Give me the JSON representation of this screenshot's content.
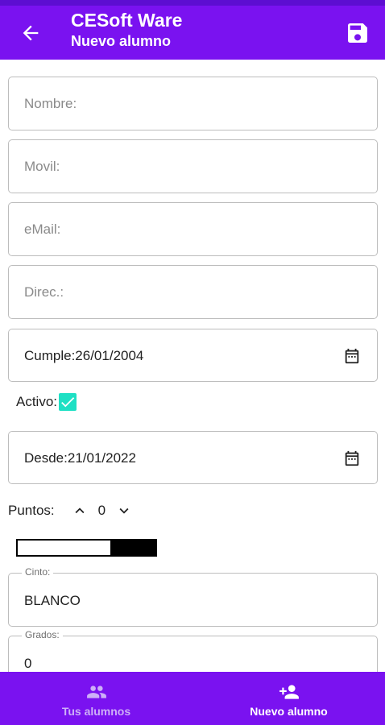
{
  "app_bar": {
    "title": "CESoft Ware",
    "subtitle": "Nuevo alumno",
    "back_icon": "arrow-back-icon",
    "save_icon": "save-icon"
  },
  "form": {
    "nombre_placeholder": "Nombre:",
    "movil_placeholder": "Movil:",
    "email_placeholder": "eMail:",
    "direc_placeholder": "Direc.:",
    "cumple_value": "Cumple:26/01/2004",
    "activo_label": "Activo:",
    "activo_checked": true,
    "desde_value": "Desde:21/01/2022",
    "puntos_label": "Puntos:",
    "puntos_value": "0",
    "cinto_label": "Cinto:",
    "cinto_value": "BLANCO",
    "grados_label": "Grados:",
    "grados_value": "0"
  },
  "bottom_nav": {
    "items": [
      {
        "label": "Tus alumnos",
        "icon": "people-icon",
        "active": false
      },
      {
        "label": "Nuevo alumno",
        "icon": "person-add-icon",
        "active": true
      }
    ]
  },
  "colors": {
    "primary": "#7a12f0",
    "status_bar": "#5d0ed1",
    "checkbox": "#1ee0c4"
  }
}
